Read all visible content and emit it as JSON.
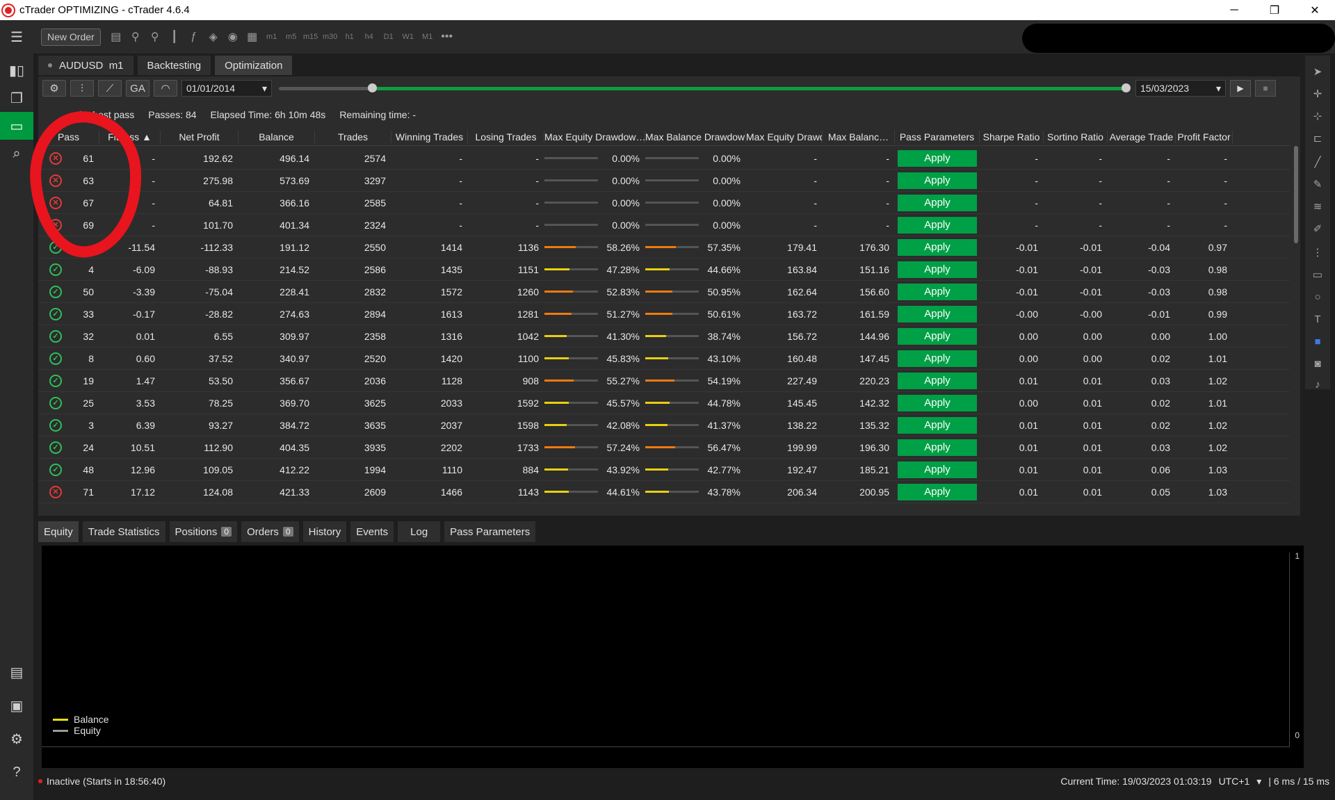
{
  "window": {
    "title": "cTrader OPTIMIZING - cTrader 4.6.4",
    "minimize": "─",
    "maximize": "❐",
    "close": "✕"
  },
  "toolbar": {
    "new_order": "New Order",
    "timeframes": [
      "m1",
      "m5",
      "m15",
      "m30",
      "h1",
      "h4",
      "D1",
      "W1",
      "M1"
    ],
    "more": "•••"
  },
  "tabs": {
    "symbol": "AUDUSD",
    "timeframe": "m1",
    "backtesting": "Backtesting",
    "optimization": "Optimization"
  },
  "controls": {
    "ga_label": "GA",
    "start_date": "01/01/2014",
    "end_date": "15/03/2023",
    "range_start": 0.11,
    "range_end": 0.999
  },
  "info": {
    "best_pass": "the best pass",
    "passes": "Passes: 84",
    "elapsed": "Elapsed Time: 6h 10m 48s",
    "remaining": "Remaining time: -"
  },
  "columns": [
    "Pass",
    "Fitness ▲",
    "Net Profit",
    "Balance",
    "Trades",
    "Winning Trades",
    "Losing Trades",
    "Max Equity Drawdow…",
    "Max Balance Drawdow…",
    "Max Equity Drawdo…",
    "Max Balanc…",
    "Pass Parameters",
    "Sharpe Ratio",
    "Sortino Ratio",
    "Average Trade",
    "Profit Factor"
  ],
  "rows": [
    {
      "status": "fail",
      "pass": "61",
      "fitness": "-",
      "net": "192.62",
      "balance": "496.14",
      "trades": "2574",
      "win": "-",
      "lose": "-",
      "eq_dd": "0.00%",
      "eq_pct": 0,
      "eq_color": "#e8a020",
      "bal_dd": "0.00%",
      "bal_pct": 0,
      "bal_color": "#e8a020",
      "max_eq": "-",
      "max_bal": "-",
      "apply": "Apply",
      "sharpe": "-",
      "sortino": "-",
      "avg": "-",
      "pf": "-"
    },
    {
      "status": "fail",
      "pass": "63",
      "fitness": "-",
      "net": "275.98",
      "balance": "573.69",
      "trades": "3297",
      "win": "-",
      "lose": "-",
      "eq_dd": "0.00%",
      "eq_pct": 0,
      "eq_color": "#e8a020",
      "bal_dd": "0.00%",
      "bal_pct": 0,
      "bal_color": "#e8a020",
      "max_eq": "-",
      "max_bal": "-",
      "apply": "Apply",
      "sharpe": "-",
      "sortino": "-",
      "avg": "-",
      "pf": "-"
    },
    {
      "status": "fail",
      "pass": "67",
      "fitness": "-",
      "net": "64.81",
      "balance": "366.16",
      "trades": "2585",
      "win": "-",
      "lose": "-",
      "eq_dd": "0.00%",
      "eq_pct": 0,
      "eq_color": "#e8a020",
      "bal_dd": "0.00%",
      "bal_pct": 0,
      "bal_color": "#e8a020",
      "max_eq": "-",
      "max_bal": "-",
      "apply": "Apply",
      "sharpe": "-",
      "sortino": "-",
      "avg": "-",
      "pf": "-"
    },
    {
      "status": "fail",
      "pass": "69",
      "fitness": "-",
      "net": "101.70",
      "balance": "401.34",
      "trades": "2324",
      "win": "-",
      "lose": "-",
      "eq_dd": "0.00%",
      "eq_pct": 0,
      "eq_color": "#e8a020",
      "bal_dd": "0.00%",
      "bal_pct": 0,
      "bal_color": "#e8a020",
      "max_eq": "-",
      "max_bal": "-",
      "apply": "Apply",
      "sharpe": "-",
      "sortino": "-",
      "avg": "-",
      "pf": "-"
    },
    {
      "status": "ok",
      "pass": "",
      "fitness": "-11.54",
      "net": "-112.33",
      "balance": "191.12",
      "trades": "2550",
      "win": "1414",
      "lose": "1136",
      "eq_dd": "58.26%",
      "eq_pct": 0.58,
      "eq_color": "#f07a10",
      "bal_dd": "57.35%",
      "bal_pct": 0.57,
      "bal_color": "#f07a10",
      "max_eq": "179.41",
      "max_bal": "176.30",
      "apply": "Apply",
      "sharpe": "-0.01",
      "sortino": "-0.01",
      "avg": "-0.04",
      "pf": "0.97"
    },
    {
      "status": "ok",
      "pass": "4",
      "fitness": "-6.09",
      "net": "-88.93",
      "balance": "214.52",
      "trades": "2586",
      "win": "1435",
      "lose": "1151",
      "eq_dd": "47.28%",
      "eq_pct": 0.47,
      "eq_color": "#e8d010",
      "bal_dd": "44.66%",
      "bal_pct": 0.45,
      "bal_color": "#e8d010",
      "max_eq": "163.84",
      "max_bal": "151.16",
      "apply": "Apply",
      "sharpe": "-0.01",
      "sortino": "-0.01",
      "avg": "-0.03",
      "pf": "0.98"
    },
    {
      "status": "ok",
      "pass": "50",
      "fitness": "-3.39",
      "net": "-75.04",
      "balance": "228.41",
      "trades": "2832",
      "win": "1572",
      "lose": "1260",
      "eq_dd": "52.83%",
      "eq_pct": 0.53,
      "eq_color": "#f07a10",
      "bal_dd": "50.95%",
      "bal_pct": 0.51,
      "bal_color": "#f07a10",
      "max_eq": "162.64",
      "max_bal": "156.60",
      "apply": "Apply",
      "sharpe": "-0.01",
      "sortino": "-0.01",
      "avg": "-0.03",
      "pf": "0.98"
    },
    {
      "status": "ok",
      "pass": "33",
      "fitness": "-0.17",
      "net": "-28.82",
      "balance": "274.63",
      "trades": "2894",
      "win": "1613",
      "lose": "1281",
      "eq_dd": "51.27%",
      "eq_pct": 0.51,
      "eq_color": "#f07a10",
      "bal_dd": "50.61%",
      "bal_pct": 0.51,
      "bal_color": "#f07a10",
      "max_eq": "163.72",
      "max_bal": "161.59",
      "apply": "Apply",
      "sharpe": "-0.00",
      "sortino": "-0.00",
      "avg": "-0.01",
      "pf": "0.99"
    },
    {
      "status": "ok",
      "pass": "32",
      "fitness": "0.01",
      "net": "6.55",
      "balance": "309.97",
      "trades": "2358",
      "win": "1316",
      "lose": "1042",
      "eq_dd": "41.30%",
      "eq_pct": 0.41,
      "eq_color": "#e8d010",
      "bal_dd": "38.74%",
      "bal_pct": 0.39,
      "bal_color": "#e8d010",
      "max_eq": "156.72",
      "max_bal": "144.96",
      "apply": "Apply",
      "sharpe": "0.00",
      "sortino": "0.00",
      "avg": "0.00",
      "pf": "1.00"
    },
    {
      "status": "ok",
      "pass": "8",
      "fitness": "0.60",
      "net": "37.52",
      "balance": "340.97",
      "trades": "2520",
      "win": "1420",
      "lose": "1100",
      "eq_dd": "45.83%",
      "eq_pct": 0.46,
      "eq_color": "#e8d010",
      "bal_dd": "43.10%",
      "bal_pct": 0.43,
      "bal_color": "#e8d010",
      "max_eq": "160.48",
      "max_bal": "147.45",
      "apply": "Apply",
      "sharpe": "0.00",
      "sortino": "0.00",
      "avg": "0.02",
      "pf": "1.01"
    },
    {
      "status": "ok",
      "pass": "19",
      "fitness": "1.47",
      "net": "53.50",
      "balance": "356.67",
      "trades": "2036",
      "win": "1128",
      "lose": "908",
      "eq_dd": "55.27%",
      "eq_pct": 0.55,
      "eq_color": "#f07a10",
      "bal_dd": "54.19%",
      "bal_pct": 0.54,
      "bal_color": "#f07a10",
      "max_eq": "227.49",
      "max_bal": "220.23",
      "apply": "Apply",
      "sharpe": "0.01",
      "sortino": "0.01",
      "avg": "0.03",
      "pf": "1.02"
    },
    {
      "status": "ok",
      "pass": "25",
      "fitness": "3.53",
      "net": "78.25",
      "balance": "369.70",
      "trades": "3625",
      "win": "2033",
      "lose": "1592",
      "eq_dd": "45.57%",
      "eq_pct": 0.46,
      "eq_color": "#e8d010",
      "bal_dd": "44.78%",
      "bal_pct": 0.45,
      "bal_color": "#e8d010",
      "max_eq": "145.45",
      "max_bal": "142.32",
      "apply": "Apply",
      "sharpe": "0.00",
      "sortino": "0.01",
      "avg": "0.02",
      "pf": "1.01"
    },
    {
      "status": "ok",
      "pass": "3",
      "fitness": "6.39",
      "net": "93.27",
      "balance": "384.72",
      "trades": "3635",
      "win": "2037",
      "lose": "1598",
      "eq_dd": "42.08%",
      "eq_pct": 0.42,
      "eq_color": "#e8d010",
      "bal_dd": "41.37%",
      "bal_pct": 0.41,
      "bal_color": "#e8d010",
      "max_eq": "138.22",
      "max_bal": "135.32",
      "apply": "Apply",
      "sharpe": "0.01",
      "sortino": "0.01",
      "avg": "0.02",
      "pf": "1.02"
    },
    {
      "status": "ok",
      "pass": "24",
      "fitness": "10.51",
      "net": "112.90",
      "balance": "404.35",
      "trades": "3935",
      "win": "2202",
      "lose": "1733",
      "eq_dd": "57.24%",
      "eq_pct": 0.57,
      "eq_color": "#f07a10",
      "bal_dd": "56.47%",
      "bal_pct": 0.56,
      "bal_color": "#f07a10",
      "max_eq": "199.99",
      "max_bal": "196.30",
      "apply": "Apply",
      "sharpe": "0.01",
      "sortino": "0.01",
      "avg": "0.03",
      "pf": "1.02"
    },
    {
      "status": "ok",
      "pass": "48",
      "fitness": "12.96",
      "net": "109.05",
      "balance": "412.22",
      "trades": "1994",
      "win": "1110",
      "lose": "884",
      "eq_dd": "43.92%",
      "eq_pct": 0.44,
      "eq_color": "#e8d010",
      "bal_dd": "42.77%",
      "bal_pct": 0.43,
      "bal_color": "#e8d010",
      "max_eq": "192.47",
      "max_bal": "185.21",
      "apply": "Apply",
      "sharpe": "0.01",
      "sortino": "0.01",
      "avg": "0.06",
      "pf": "1.03"
    },
    {
      "status": "fail",
      "pass": "71",
      "fitness": "17.12",
      "net": "124.08",
      "balance": "421.33",
      "trades": "2609",
      "win": "1466",
      "lose": "1143",
      "eq_dd": "44.61%",
      "eq_pct": 0.45,
      "eq_color": "#e8d010",
      "bal_dd": "43.78%",
      "bal_pct": 0.44,
      "bal_color": "#e8d010",
      "max_eq": "206.34",
      "max_bal": "200.95",
      "apply": "Apply",
      "sharpe": "0.01",
      "sortino": "0.01",
      "avg": "0.05",
      "pf": "1.03"
    }
  ],
  "bottom_tabs": {
    "equity": "Equity",
    "trade_stats": "Trade Statistics",
    "positions": "Positions",
    "positions_count": "0",
    "orders": "Orders",
    "orders_count": "0",
    "history": "History",
    "events": "Events",
    "log": "Log",
    "pass_params": "Pass Parameters"
  },
  "chart": {
    "y_top": "1",
    "y_bottom": "0",
    "legend": [
      {
        "name": "Balance",
        "color": "#e8e000"
      },
      {
        "name": "Equity",
        "color": "#9a9a9a"
      }
    ]
  },
  "status": {
    "inactive": "Inactive (Starts in 18:56:40)",
    "current_time": "Current Time: 19/03/2023 01:03:19",
    "timezone": "UTC+1",
    "latency": "| 6 ms / 15 ms"
  }
}
